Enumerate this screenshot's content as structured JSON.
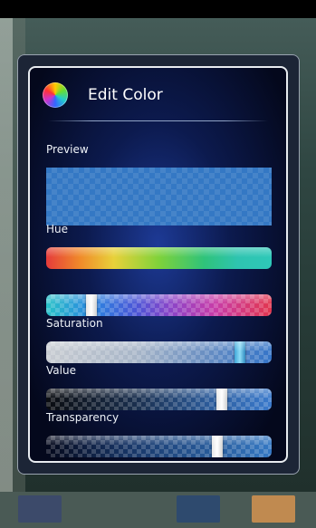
{
  "dialog": {
    "title": "Edit Color",
    "icon": "color-wheel-icon",
    "preview_label": "Preview",
    "preview_color": "#3478c4",
    "hue_label": "Hue",
    "saturation_label": "Saturation",
    "value_label": "Value",
    "transparency_label": "Transparency"
  },
  "sliders": {
    "hue": 0.2,
    "saturation": 0.86,
    "value": 0.78,
    "transparency": 0.76
  }
}
